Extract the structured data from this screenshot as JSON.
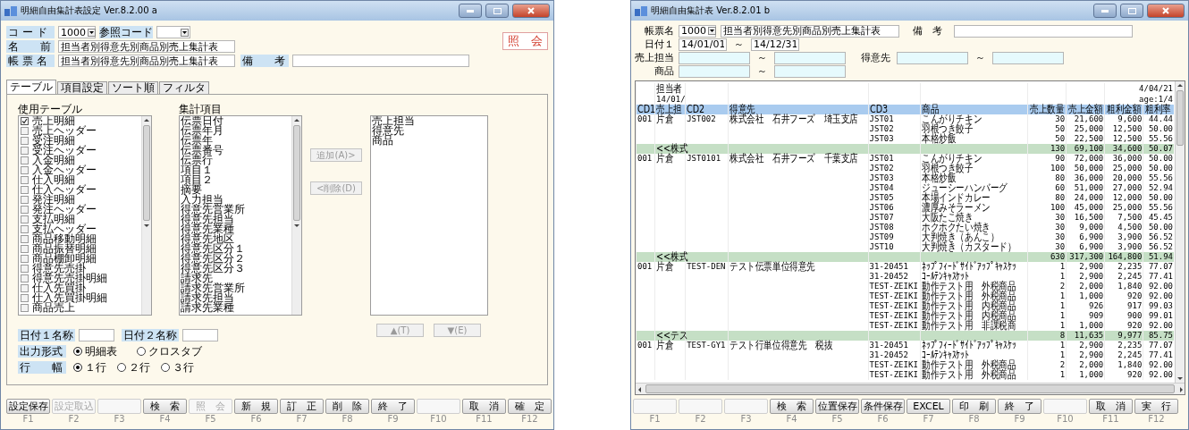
{
  "left_window": {
    "title": "明細自由集計表設定 Ver.8.2.00 a",
    "code": {
      "label": "コ ー ド",
      "value": "1000"
    },
    "ref_code": {
      "label": "参照コード"
    },
    "mode_label": "照　会",
    "name": {
      "label": "名　　前",
      "value": "担当者別得意先別商品別売上集計表"
    },
    "report_name": {
      "label": "帳 票 名",
      "value": "担当者別得意先別商品別売上集計表"
    },
    "remarks": {
      "label": "備　　考"
    },
    "tabs": [
      {
        "label": "テーブル",
        "selected": true
      },
      {
        "label": "項目設定",
        "selected": false
      },
      {
        "label": "ソート順",
        "selected": false
      },
      {
        "label": "フィルタ",
        "selected": false
      }
    ],
    "table_list": {
      "label": "使用テーブル",
      "items": [
        {
          "label": "売上明細",
          "checked": true
        },
        {
          "label": "売上ヘッダー",
          "checked": false
        },
        {
          "label": "受注明細",
          "checked": false
        },
        {
          "label": "受注ヘッダー",
          "checked": false
        },
        {
          "label": "入金明細",
          "checked": false
        },
        {
          "label": "入金ヘッダー",
          "checked": false
        },
        {
          "label": "仕入明細",
          "checked": false
        },
        {
          "label": "仕入ヘッダー",
          "checked": false
        },
        {
          "label": "発注明細",
          "checked": false
        },
        {
          "label": "発注ヘッダー",
          "checked": false
        },
        {
          "label": "支払明細",
          "checked": false
        },
        {
          "label": "支払ヘッダー",
          "checked": false
        },
        {
          "label": "商品移動明細",
          "checked": false
        },
        {
          "label": "商品振替明細",
          "checked": false
        },
        {
          "label": "商品棚卸明細",
          "checked": false
        },
        {
          "label": "得意先売掛",
          "checked": false
        },
        {
          "label": "得意先売掛明細",
          "checked": false
        },
        {
          "label": "仕入先買掛",
          "checked": false
        },
        {
          "label": "仕入先買掛明細",
          "checked": false
        },
        {
          "label": "商品売上",
          "checked": false
        }
      ]
    },
    "item_list": {
      "label": "集計項目",
      "items": [
        "伝票日付",
        "伝票年月",
        "伝票年",
        "伝票番号",
        "伝票行",
        "項目１",
        "項目２",
        "摘要",
        "入力担当",
        "得意先営業所",
        "得意先担当",
        "得意先業種",
        "得意先地区",
        "得意先区分１",
        "得意先区分２",
        "得意先区分３",
        "請求先",
        "請求先営業所",
        "請求先担当",
        "請求先業種"
      ]
    },
    "selected_list": {
      "items": [
        "売上担当",
        "得意先",
        "商品"
      ]
    },
    "move_buttons": [
      {
        "label": "追加(A)>",
        "disabled": true
      },
      {
        "label": "<削除(D)",
        "disabled": true
      }
    ],
    "order_buttons": [
      {
        "label": "▲(T)",
        "disabled": true
      },
      {
        "label": "▼(E)",
        "disabled": true
      }
    ],
    "date_names": [
      {
        "label": "日付１名称"
      },
      {
        "label": "日付２名称"
      }
    ],
    "output_format": {
      "label": "出力形式",
      "options": [
        {
          "label": "明細表",
          "selected": true
        },
        {
          "label": "クロスタブ",
          "selected": false
        }
      ]
    },
    "row_width": {
      "label": "行　　幅",
      "options": [
        {
          "label": "１行",
          "selected": true
        },
        {
          "label": "２行",
          "selected": false
        },
        {
          "label": "３行",
          "selected": false
        }
      ]
    },
    "function_keys": [
      {
        "key": "F1",
        "label": "設定保存",
        "disabled": false
      },
      {
        "key": "F2",
        "label": "設定取込",
        "disabled": true
      },
      {
        "key": "F3",
        "disabled": true
      },
      {
        "key": "F4",
        "label": "検　索",
        "disabled": false
      },
      {
        "key": "F5",
        "label": "照　会",
        "disabled": true
      },
      {
        "key": "F6",
        "label": "新　規",
        "disabled": false
      },
      {
        "key": "F7",
        "label": "訂　正",
        "disabled": false
      },
      {
        "key": "F8",
        "label": "削　除",
        "disabled": false
      },
      {
        "key": "F9",
        "label": "終　了",
        "disabled": false
      },
      {
        "key": "F10",
        "disabled": true
      },
      {
        "key": "F11",
        "label": "取　消",
        "disabled": false
      },
      {
        "key": "F12",
        "label": "確　定",
        "disabled": false
      }
    ]
  },
  "right_window": {
    "title": "明細自由集計表 Ver.8.2.01 b",
    "report_name": {
      "label": "帳票名",
      "code": "1000",
      "value": "担当者別得意先別商品別売上集計表"
    },
    "remarks": {
      "label": "備　考"
    },
    "date1": {
      "label": "日付１",
      "from": "14/01/01",
      "to": "14/12/31"
    },
    "range_separators": [
      "～",
      "～",
      "～",
      "～"
    ],
    "staff": {
      "label": "売上担当"
    },
    "customer": {
      "label": "得意先"
    },
    "product": {
      "label": "商品"
    },
    "report": {
      "header_left": [
        "担当者",
        "14/01/"
      ],
      "header_right": [
        "4/04/21",
        "age:1/4"
      ],
      "columns": [
        "CD1",
        "売上担",
        "CD2",
        "得意先",
        "CD3",
        "商品",
        "売上数量",
        "売上金額",
        "粗利金額",
        "粗利率"
      ],
      "groups": [
        {
          "cd1": "001",
          "staff": "片倉",
          "cd2": "JST002",
          "customer": "株式会社　石井フーズ　埼玉支店",
          "items": [
            {
              "cd3": "JST01",
              "product": "こんがりチキン",
              "qty": "30",
              "amount": "21,600",
              "profit": "9,600",
              "rate": "44.44"
            },
            {
              "cd3": "JST02",
              "product": "羽根つき餃子",
              "qty": "50",
              "amount": "25,000",
              "profit": "12,500",
              "rate": "50.00"
            },
            {
              "cd3": "JST03",
              "product": "本格炒飯",
              "qty": "50",
              "amount": "22,500",
              "profit": "12,500",
              "rate": "55.56"
            }
          ],
          "subtotal": {
            "label": "<<株式",
            "qty": "130",
            "amount": "69,100",
            "profit": "34,600",
            "rate": "50.07"
          }
        },
        {
          "cd1": "001",
          "staff": "片倉",
          "cd2": "JST0101",
          "customer": "株式会社　石井フーズ　千葉支店",
          "items": [
            {
              "cd3": "JST01",
              "product": "こんがりチキン",
              "qty": "90",
              "amount": "72,000",
              "profit": "36,000",
              "rate": "50.00"
            },
            {
              "cd3": "JST02",
              "product": "羽根つき餃子",
              "qty": "100",
              "amount": "50,000",
              "profit": "25,000",
              "rate": "50.00"
            },
            {
              "cd3": "JST03",
              "product": "本格炒飯",
              "qty": "80",
              "amount": "36,000",
              "profit": "20,000",
              "rate": "55.56"
            },
            {
              "cd3": "JST04",
              "product": "ジューシーハンバーグ",
              "qty": "60",
              "amount": "51,000",
              "profit": "27,000",
              "rate": "52.94"
            },
            {
              "cd3": "JST05",
              "product": "本場インドカレー",
              "qty": "80",
              "amount": "24,000",
              "profit": "12,000",
              "rate": "50.00"
            },
            {
              "cd3": "JST06",
              "product": "濃厚みそラーメン",
              "qty": "100",
              "amount": "45,000",
              "profit": "25,000",
              "rate": "55.56"
            },
            {
              "cd3": "JST07",
              "product": "大阪たこ焼き",
              "qty": "30",
              "amount": "16,500",
              "profit": "7,500",
              "rate": "45.45"
            },
            {
              "cd3": "JST08",
              "product": "ホクホクたい焼き",
              "qty": "30",
              "amount": "9,000",
              "profit": "4,500",
              "rate": "50.00"
            },
            {
              "cd3": "JST09",
              "product": "大判焼き（あんこ）",
              "qty": "30",
              "amount": "6,900",
              "profit": "3,900",
              "rate": "56.52"
            },
            {
              "cd3": "JST10",
              "product": "大判焼き（カスタード）",
              "qty": "30",
              "amount": "6,900",
              "profit": "3,900",
              "rate": "56.52"
            }
          ],
          "subtotal": {
            "label": "<<株式",
            "qty": "630",
            "amount": "317,300",
            "profit": "164,800",
            "rate": "51.94"
          }
        },
        {
          "cd1": "001",
          "staff": "片倉",
          "cd2": "TEST-DEN",
          "customer": "テスト伝票単位得意先",
          "items": [
            {
              "cd3": "31-20451",
              "product": "ﾈｯﾌﾟﾌｨｰﾄﾞｻｲﾄﾞｱｯﾌﾟｷｬｽｹｯ",
              "qty": "1",
              "amount": "2,900",
              "profit": "2,235",
              "rate": "77.07"
            },
            {
              "cd3": "31-20452",
              "product": "ｺｰﾙﾃﾝｷｬｽｹｯﾄ",
              "qty": "1",
              "amount": "2,900",
              "profit": "2,245",
              "rate": "77.41"
            },
            {
              "cd3": "TEST-ZEIKI",
              "product": "動作テスト用　外税商品",
              "qty": "2",
              "amount": "2,000",
              "profit": "1,840",
              "rate": "92.00"
            },
            {
              "cd3": "TEST-ZEIKI",
              "product": "動作テスト用　外税商品",
              "qty": "1",
              "amount": "1,000",
              "profit": "920",
              "rate": "92.00"
            },
            {
              "cd3": "TEST-ZEIKI",
              "product": "動作テスト用　内税商品",
              "qty": "1",
              "amount": "926",
              "profit": "917",
              "rate": "99.03"
            },
            {
              "cd3": "TEST-ZEIKI",
              "product": "動作テスト用　内税商品",
              "qty": "1",
              "amount": "909",
              "profit": "900",
              "rate": "99.01"
            },
            {
              "cd3": "TEST-ZEIKI",
              "product": "動作テスト用　非課税商",
              "qty": "1",
              "amount": "1,000",
              "profit": "920",
              "rate": "92.00"
            }
          ],
          "subtotal": {
            "label": "<<テス",
            "qty": "8",
            "amount": "11,635",
            "profit": "9,977",
            "rate": "85.75"
          }
        },
        {
          "cd1": "001",
          "staff": "片倉",
          "cd2": "TEST-GY1",
          "customer": "テスト行単位得意先　税抜",
          "items": [
            {
              "cd3": "31-20451",
              "product": "ﾈｯﾌﾟﾌｨｰﾄﾞｻｲﾄﾞｱｯﾌﾟｷｬｽｹｯ",
              "qty": "1",
              "amount": "2,900",
              "profit": "2,235",
              "rate": "77.07"
            },
            {
              "cd3": "31-20452",
              "product": "ｺｰﾙﾃﾝｷｬｽｹｯﾄ",
              "qty": "1",
              "amount": "2,900",
              "profit": "2,245",
              "rate": "77.41"
            },
            {
              "cd3": "TEST-ZEIKI",
              "product": "動作テスト用　外税商品",
              "qty": "2",
              "amount": "2,000",
              "profit": "1,840",
              "rate": "92.00"
            },
            {
              "cd3": "TEST-ZEIKI",
              "product": "動作テスト用　外税商品",
              "qty": "1",
              "amount": "1,000",
              "profit": "920",
              "rate": "92.00"
            }
          ]
        }
      ]
    },
    "function_keys": [
      {
        "key": "F1",
        "disabled": true
      },
      {
        "key": "F2",
        "disabled": true
      },
      {
        "key": "F3",
        "disabled": true
      },
      {
        "key": "F4",
        "label": "検　索",
        "disabled": false
      },
      {
        "key": "F5",
        "label": "位置保存",
        "disabled": false
      },
      {
        "key": "F6",
        "label": "条件保存",
        "disabled": false
      },
      {
        "key": "F7",
        "label": "EXCEL",
        "disabled": false
      },
      {
        "key": "F8",
        "label": "印　刷",
        "disabled": false
      },
      {
        "key": "F9",
        "label": "終　了",
        "disabled": false
      },
      {
        "key": "F10",
        "disabled": true
      },
      {
        "key": "F11",
        "label": "取　消",
        "disabled": false
      },
      {
        "key": "F12",
        "label": "実　行",
        "disabled": false
      }
    ]
  }
}
